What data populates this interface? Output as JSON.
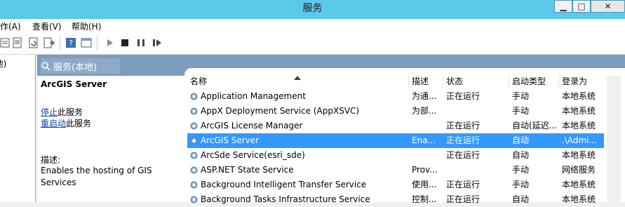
{
  "window": {
    "title": "服务",
    "minimize": "▁",
    "maximize": "□",
    "close": "✕"
  },
  "menu": [
    "操作(A)",
    "查看(V)",
    "帮助(H)"
  ],
  "tree": {
    "item": "(本地)"
  },
  "header": {
    "title": "服务(本地)"
  },
  "details": {
    "service_name": "ArcGIS Server",
    "stop_link": "停止",
    "stop_suffix": "此服务",
    "restart_link": "重启动",
    "restart_suffix": "此服务",
    "desc_label": "描述:",
    "desc_text": "Enables the hosting of GIS Services"
  },
  "columns": {
    "name": "名称",
    "desc": "描述",
    "status": "状态",
    "startup": "启动类型",
    "logon": "登录为"
  },
  "rows": [
    {
      "name": "Application Management",
      "desc": "为通...",
      "status": "正在运行",
      "startup": "手动",
      "logon": "本地系统"
    },
    {
      "name": "AppX Deployment Service (AppXSVC)",
      "desc": "为部...",
      "status": "",
      "startup": "手动",
      "logon": "本地系统"
    },
    {
      "name": "ArcGIS License Manager",
      "desc": "",
      "status": "正在运行",
      "startup": "自动(延迟...",
      "logon": "本地系统"
    },
    {
      "name": "ArcGIS Server",
      "desc": "Ena...",
      "status": "正在运行",
      "startup": "自动",
      "logon": ".\\Admi..."
    },
    {
      "name": "ArcSde Service(esri_sde)",
      "desc": "",
      "status": "正在运行",
      "startup": "自动",
      "logon": "本地系统"
    },
    {
      "name": "ASP.NET State Service",
      "desc": "Prov...",
      "status": "",
      "startup": "手动",
      "logon": "网络服务"
    },
    {
      "name": "Background Intelligent Transfer Service",
      "desc": "使用...",
      "status": "正在运行",
      "startup": "手动",
      "logon": "本地系统"
    },
    {
      "name": "Background Tasks Infrastructure Service",
      "desc": "控制...",
      "status": "正在运行",
      "startup": "自动",
      "logon": "本地系统"
    }
  ],
  "selected_row": 3,
  "colors": {
    "titlebar": "#5cc8ea",
    "selection": "#3399ff",
    "header": "#7c9cc0"
  }
}
